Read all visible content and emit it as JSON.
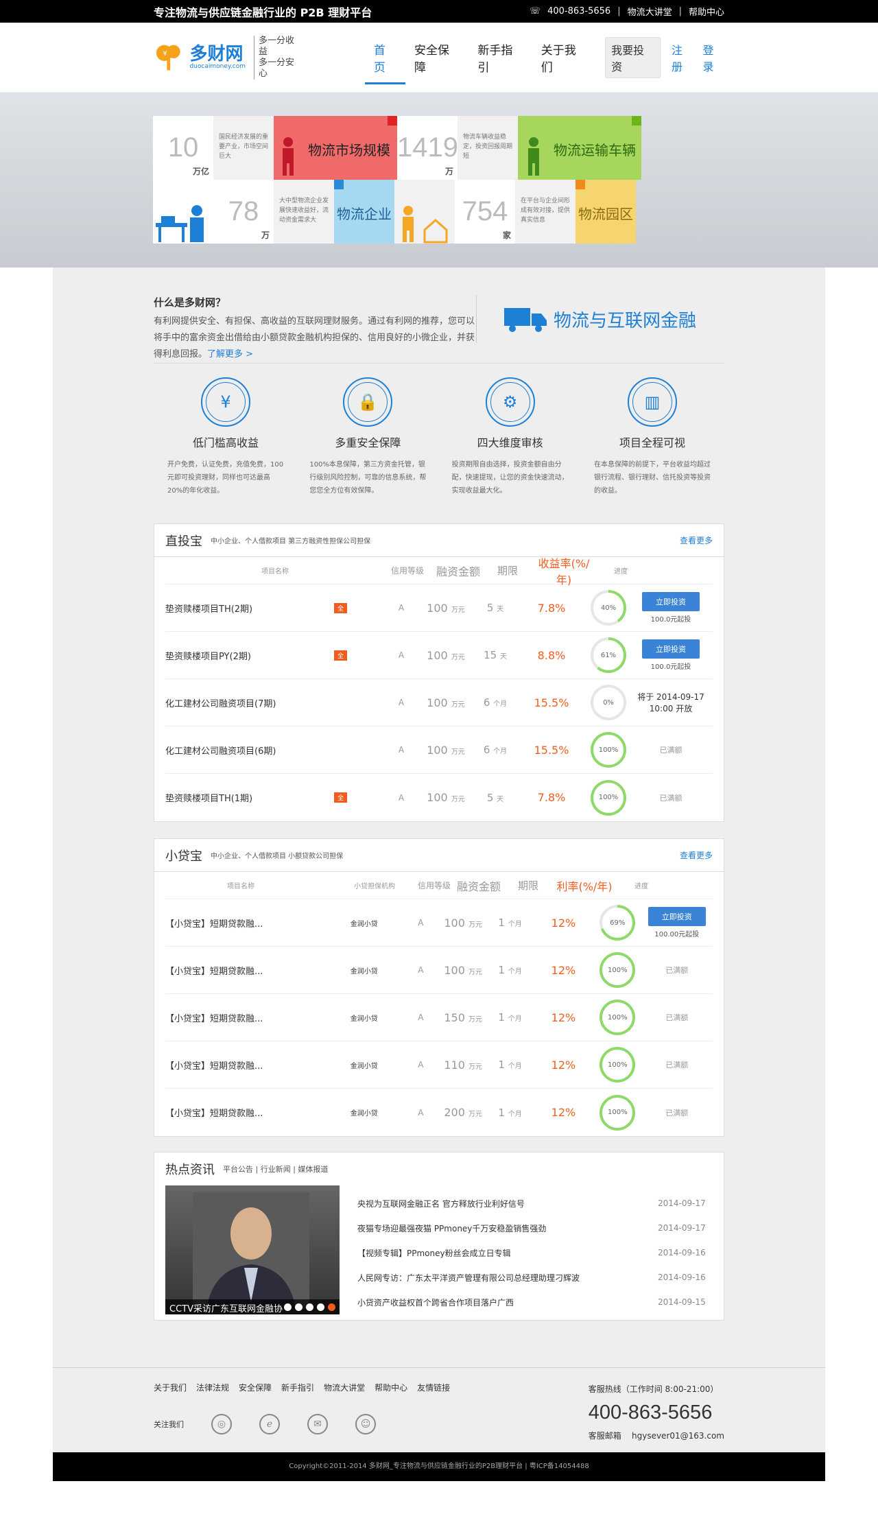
{
  "topbar": {
    "slogan": "专注物流与供应链金融行业的 P2B 理财平台",
    "phone": "400-863-5656",
    "link1": "物流大讲堂",
    "link2": "帮助中心"
  },
  "logo": {
    "name": "多财网",
    "sub": "duocaimoney.com",
    "tag1": "多一分收益",
    "tag2": "多一分安心"
  },
  "nav": {
    "items": [
      "首页",
      "安全保障",
      "新手指引",
      "关于我们"
    ],
    "invest": "我要投资",
    "register": "注册",
    "login": "登录"
  },
  "banner": {
    "t1": {
      "num": "10",
      "unit": "万亿",
      "desc": "国民经济发展的重要产业，市场空间巨大"
    },
    "t2": {
      "label": "物流市场规模"
    },
    "t3": {
      "num": "1419",
      "unit": "万",
      "desc": "物流车辆收益稳定，投资回报周期短"
    },
    "t4": {
      "label": "物流运输车辆"
    },
    "t5": {
      "num": "78",
      "unit": "万",
      "desc": "大中型物流企业发展快速收益好，流动资金需求大"
    },
    "t6": {
      "label": "物流企业"
    },
    "t7": {
      "num": "754",
      "unit": "家",
      "desc": "在平台与企业间形成有效对接，提供真实信息"
    },
    "t8": {
      "label": "物流园区"
    },
    "colors": {
      "red": "#f06a6a",
      "green": "#a6d65c",
      "blue": "#a7d8f2",
      "yellow": "#f7d56e"
    }
  },
  "intro": {
    "title": "什么是多财网？",
    "text": "有利网提供安全、有担保、高收益的互联网理财服务。通过有利网的推荐，您可以将手中的富余资金出借给由小额贷款金融机构担保的、信用良好的小微企业，并获得利息回报。",
    "more": "了解更多 >",
    "slogan": "物流与互联网金融"
  },
  "features": [
    {
      "icon": "yen-icon",
      "title": "低门槛高收益",
      "text": "开户免费，认证免费，充值免费，100元即可投资理财，同样也可达最高20%的年化收益。"
    },
    {
      "icon": "lock-shield-icon",
      "title": "多重安全保障",
      "text": "100%本息保障，第三方资金托管，银行级别风险控制，可靠的信息系统，帮您您全方位有效保障。"
    },
    {
      "icon": "gear-check-icon",
      "title": "四大维度审核",
      "text": "投资期限自由选择，投资金额自由分配，快速提现，让您的资金快速流动，实现收益最大化。"
    },
    {
      "icon": "chart-monitor-icon",
      "title": "项目全程可视",
      "text": "在本息保障的前提下，平台收益均超过银行流程、银行理财、信托投资等投资的收益。"
    }
  ],
  "zhitoubao": {
    "title": "直投宝",
    "sub": "中小企业、个人借款项目 第三方融资性担保公司担保",
    "more": "查看更多",
    "headers": [
      "项目名称",
      "信用等级",
      "融资金额",
      "期限",
      "收益率(%/年)",
      "进度"
    ],
    "rows": [
      {
        "name": "垫资赎楼项目TH(2期)",
        "tag": "全",
        "rating": "A",
        "amount": "100",
        "amount_unit": "万元",
        "term": "5",
        "term_unit": "天",
        "rate": "7.8%",
        "progress": "40%",
        "pv": 40,
        "act": "立即投资",
        "act_sub": "100.0元起投"
      },
      {
        "name": "垫资赎楼项目PY(2期)",
        "tag": "全",
        "rating": "A",
        "amount": "100",
        "amount_unit": "万元",
        "term": "15",
        "term_unit": "天",
        "rate": "8.8%",
        "progress": "61%",
        "pv": 61,
        "act": "立即投资",
        "act_sub": "100.0元起投"
      },
      {
        "name": "化工建材公司融资项目(7期)",
        "tag": "",
        "rating": "A",
        "amount": "100",
        "amount_unit": "万元",
        "term": "6",
        "term_unit": "个月",
        "rate": "15.5%",
        "progress": "0%",
        "pv": 0,
        "act_text1": "将于 2014-09-17",
        "act_text2": "10:00 开放"
      },
      {
        "name": "化工建材公司融资项目(6期)",
        "tag": "",
        "rating": "A",
        "amount": "100",
        "amount_unit": "万元",
        "term": "6",
        "term_unit": "个月",
        "rate": "15.5%",
        "progress": "100%",
        "pv": 100,
        "done": "已满额"
      },
      {
        "name": "垫资赎楼项目TH(1期)",
        "tag": "全",
        "rating": "A",
        "amount": "100",
        "amount_unit": "万元",
        "term": "5",
        "term_unit": "天",
        "rate": "7.8%",
        "progress": "100%",
        "pv": 100,
        "done": "已满额"
      }
    ]
  },
  "xiaodaibao": {
    "title": "小贷宝",
    "sub": "中小企业、个人借款项目 小额贷款公司担保",
    "more": "查看更多",
    "headers": [
      "项目名称",
      "小贷担保机构",
      "信用等级",
      "融资金额",
      "期限",
      "利率(%/年)",
      "进度"
    ],
    "rows": [
      {
        "name": "【小贷宝】短期贷款融...",
        "org": "金润小贷",
        "rating": "A",
        "amount": "100",
        "amount_unit": "万元",
        "term": "1",
        "term_unit": "个月",
        "rate": "12%",
        "progress": "69%",
        "pv": 69,
        "act": "立即投资",
        "act_sub": "100.00元起投"
      },
      {
        "name": "【小贷宝】短期贷款融...",
        "org": "金润小贷",
        "rating": "A",
        "amount": "100",
        "amount_unit": "万元",
        "term": "1",
        "term_unit": "个月",
        "rate": "12%",
        "progress": "100%",
        "pv": 100,
        "done": "已满额"
      },
      {
        "name": "【小贷宝】短期贷款融...",
        "org": "金润小贷",
        "rating": "A",
        "amount": "150",
        "amount_unit": "万元",
        "term": "1",
        "term_unit": "个月",
        "rate": "12%",
        "progress": "100%",
        "pv": 100,
        "done": "已满额"
      },
      {
        "name": "【小贷宝】短期贷款融...",
        "org": "金润小贷",
        "rating": "A",
        "amount": "110",
        "amount_unit": "万元",
        "term": "1",
        "term_unit": "个月",
        "rate": "12%",
        "progress": "100%",
        "pv": 100,
        "done": "已满额"
      },
      {
        "name": "【小贷宝】短期贷款融...",
        "org": "金润小贷",
        "rating": "A",
        "amount": "200",
        "amount_unit": "万元",
        "term": "1",
        "term_unit": "个月",
        "rate": "12%",
        "progress": "100%",
        "pv": 100,
        "done": "已满额"
      }
    ]
  },
  "news": {
    "title": "热点资讯",
    "sub": "平台公告 | 行业新闻 | 媒体报道",
    "caption": "CCTV采访广东互联网金融协会会长陈...",
    "items": [
      {
        "title": "央视为互联网金融正名 官方释放行业利好信号",
        "date": "2014-09-17"
      },
      {
        "title": "夜猫专场迎最强夜猫 PPmoney千万安稳盈销售强劲",
        "date": "2014-09-17"
      },
      {
        "title": "【视频专辑】PPmoney粉丝会成立日专辑",
        "date": "2014-09-16"
      },
      {
        "title": "人民网专访：广东太平洋资产管理有限公司总经理助理刁辉波",
        "date": "2014-09-16"
      },
      {
        "title": "小贷资产收益权首个跨省合作项目落户广西",
        "date": "2014-09-15"
      }
    ]
  },
  "footer": {
    "links": [
      "关于我们",
      "法律法规",
      "安全保障",
      "新手指引",
      "物流大讲堂",
      "帮助中心",
      "友情链接"
    ],
    "follow": "关注我们",
    "hotline_label": "客服热线（工作时间 8:00-21:00）",
    "hotline": "400-863-5656",
    "mail_label": "客服邮箱",
    "mail": "hgysever01@163.com",
    "copyright": "Copyright©2011-2014 多财网_专注物流与供应链金融行业的P2B理财平台 | 粤ICP备14054488"
  }
}
